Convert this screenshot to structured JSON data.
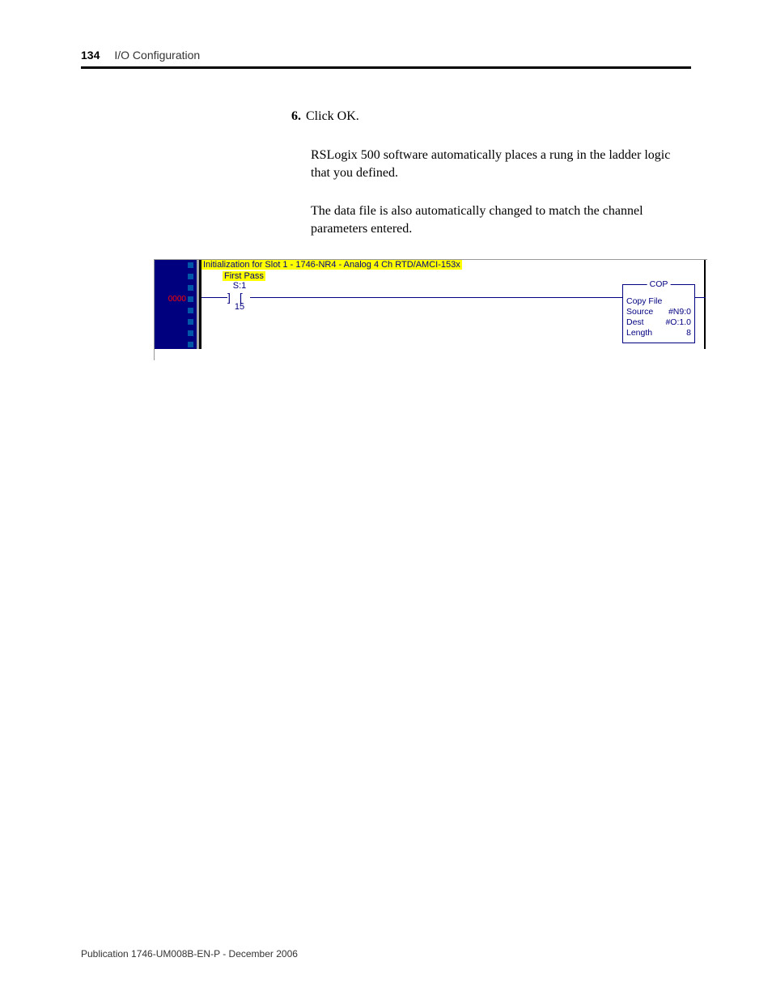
{
  "header": {
    "page_number": "134",
    "chapter": "I/O Configuration"
  },
  "step": {
    "number": "6.",
    "text": "Click OK."
  },
  "paragraphs": {
    "p1": "RSLogix 500 software automatically places a rung in the ladder logic that you defined.",
    "p2": "The data file is also automatically changed to match the channel parameters entered."
  },
  "ladder": {
    "rung_comment": "Initialization for Slot 1 - 1746-NR4 - Analog 4 Ch RTD/AMCI-153x",
    "gutter_label": "0000",
    "contact": {
      "label": "First Pass",
      "address_top": "S:1",
      "address_bottom": "15"
    },
    "cop": {
      "title": "COP",
      "name": "Copy File",
      "rows": {
        "source_label": "Source",
        "source_value": "#N9:0",
        "dest_label": "Dest",
        "dest_value": "#O:1.0",
        "length_label": "Length",
        "length_value": "8"
      }
    }
  },
  "footer": {
    "publication": "Publication 1746-UM008B-EN-P - December 2006"
  }
}
